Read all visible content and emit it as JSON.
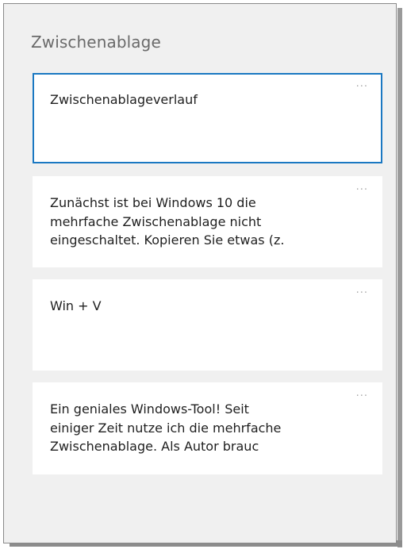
{
  "panel": {
    "title": "Zwischenablage"
  },
  "clipboard_items": [
    {
      "text": "Zwischenablageverlauf",
      "more_icon": "···",
      "selected": true
    },
    {
      "text": "Zunächst ist bei Windows 10 die\nmehrfache Zwischenablage nicht\neingeschaltet. Kopieren Sie etwas (z.",
      "more_icon": "···",
      "selected": false
    },
    {
      "text": "Win + V",
      "more_icon": "···",
      "selected": false
    },
    {
      "text": "Ein geniales Windows-Tool! Seit\neiniger Zeit nutze ich die mehrfache\nZwischenablage. Als Autor brauc",
      "more_icon": "···",
      "selected": false
    }
  ],
  "colors": {
    "panel_background": "#f0f0f0",
    "card_background": "#ffffff",
    "selection_border": "#1a78c2",
    "title_text": "#6a6a6a"
  },
  "icons": {
    "more": "more-options-icon"
  }
}
